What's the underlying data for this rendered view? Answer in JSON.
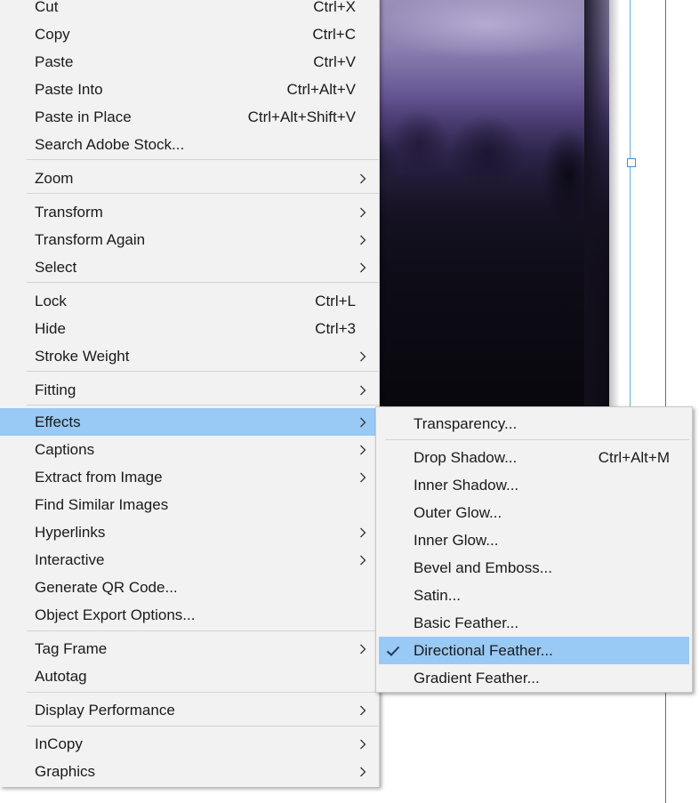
{
  "main_menu": {
    "items": [
      {
        "label": "Cut",
        "shortcut": "Ctrl+X"
      },
      {
        "label": "Copy",
        "shortcut": "Ctrl+C"
      },
      {
        "label": "Paste",
        "shortcut": "Ctrl+V"
      },
      {
        "label": "Paste Into",
        "shortcut": "Ctrl+Alt+V"
      },
      {
        "label": "Paste in Place",
        "shortcut": "Ctrl+Alt+Shift+V"
      },
      {
        "label": "Search Adobe Stock..."
      },
      {
        "label": "Zoom"
      },
      {
        "label": "Transform"
      },
      {
        "label": "Transform Again"
      },
      {
        "label": "Select"
      },
      {
        "label": "Lock",
        "shortcut": "Ctrl+L"
      },
      {
        "label": "Hide",
        "shortcut": "Ctrl+3"
      },
      {
        "label": "Stroke Weight"
      },
      {
        "label": "Fitting"
      },
      {
        "label": "Effects"
      },
      {
        "label": "Captions"
      },
      {
        "label": "Extract from Image"
      },
      {
        "label": "Find Similar Images"
      },
      {
        "label": "Hyperlinks"
      },
      {
        "label": "Interactive"
      },
      {
        "label": "Generate QR Code..."
      },
      {
        "label": "Object Export Options..."
      },
      {
        "label": "Tag Frame"
      },
      {
        "label": "Autotag"
      },
      {
        "label": "Display Performance"
      },
      {
        "label": "InCopy"
      },
      {
        "label": "Graphics"
      }
    ]
  },
  "effects_submenu": {
    "items": [
      {
        "label": "Transparency..."
      },
      {
        "label": "Drop Shadow...",
        "shortcut": "Ctrl+Alt+M"
      },
      {
        "label": "Inner Shadow..."
      },
      {
        "label": "Outer Glow..."
      },
      {
        "label": "Inner Glow..."
      },
      {
        "label": "Bevel and Emboss..."
      },
      {
        "label": "Satin..."
      },
      {
        "label": "Basic Feather..."
      },
      {
        "label": "Directional Feather...",
        "checked": true
      },
      {
        "label": "Gradient Feather..."
      }
    ]
  },
  "colors": {
    "highlight": "#99c9f5",
    "menu_bg": "#f2f2f2",
    "guide_purple": "#9b4aa6",
    "guide_cyan": "#5ab6c8"
  }
}
